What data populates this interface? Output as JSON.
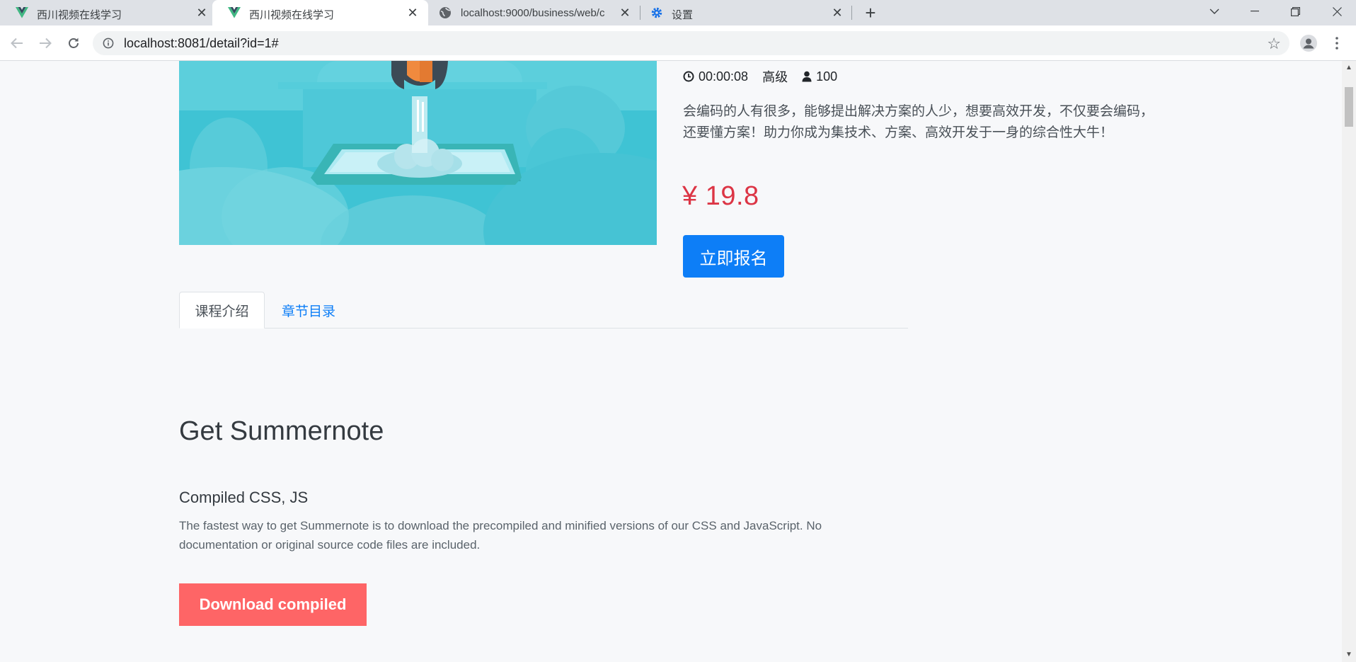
{
  "browser": {
    "tabs": [
      {
        "title": "西川视频在线学习",
        "icon": "vue-logo-icon",
        "active": false
      },
      {
        "title": "西川视频在线学习",
        "icon": "vue-logo-icon",
        "active": true
      },
      {
        "title": "localhost:9000/business/web/c",
        "icon": "globe-icon",
        "active": false
      },
      {
        "title": "设置",
        "icon": "gear-icon",
        "active": false
      }
    ],
    "url": "localhost:8081/detail?id=1#"
  },
  "course": {
    "duration": "00:00:08",
    "level": "高级",
    "enroll_count": "100",
    "description": "会编码的人有很多，能够提出解决方案的人少，想要高效开发，不仅要会编码，还要懂方案！助力你成为集技术、方案、高效开发于一身的综合性大牛！",
    "price": "¥ 19.8",
    "enroll_button": "立即报名"
  },
  "detail_tabs": {
    "intro": "课程介绍",
    "chapters": "章节目录"
  },
  "content": {
    "heading": "Get Summernote",
    "subheading": "Compiled CSS, JS",
    "paragraph": "The fastest way to get Summernote is to download the precompiled and minified versions of our CSS and JavaScript. No documentation or original source code files are included.",
    "download_button": "Download compiled"
  },
  "colors": {
    "accent": "#0d7ef7",
    "price": "#dc3545",
    "download": "#fe6566"
  }
}
